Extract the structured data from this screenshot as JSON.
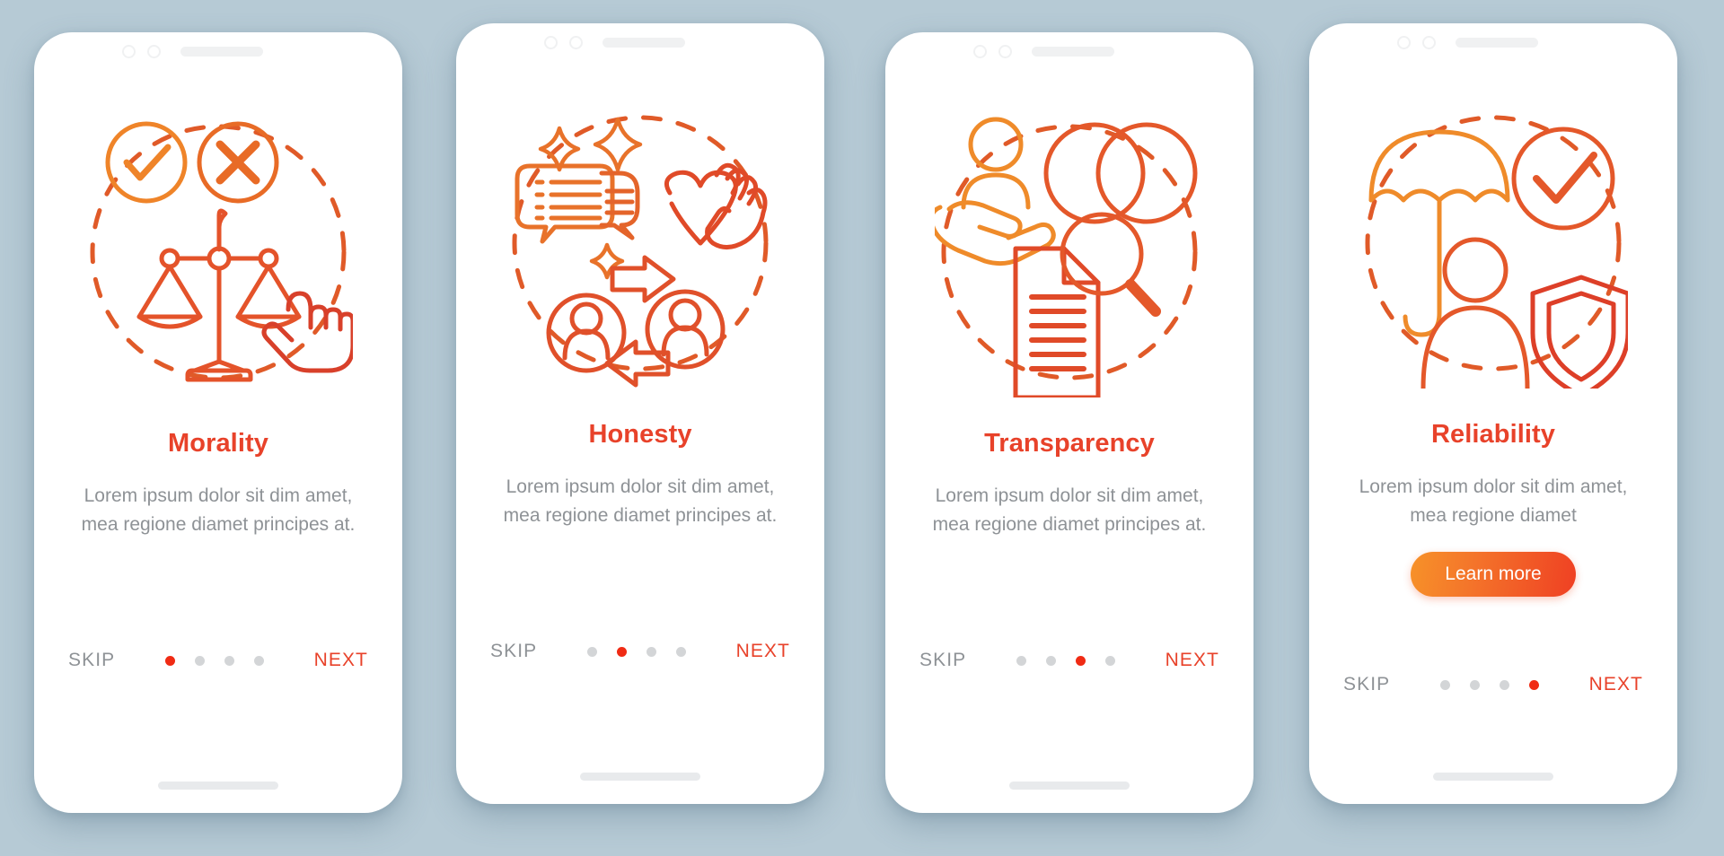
{
  "background_color": "#b6cad5",
  "theme": {
    "title_color": "#e8422a",
    "body_text_color": "#8e9296",
    "accent_dot_color": "#f02b14",
    "inactive_dot_color": "#d3d5d7",
    "cta_gradient_from": "#f79229",
    "cta_gradient_to": "#ef4023"
  },
  "common": {
    "skip_label": "SKIP",
    "next_label": "NEXT",
    "total_dots": 4
  },
  "screens": [
    {
      "id": "morality",
      "title": "Morality",
      "description": "Lorem ipsum dolor sit dim amet, mea regione diamet principes at.",
      "active_dot": 1,
      "has_cta": false,
      "cta_label": "",
      "illustration_name": "morality-illustration",
      "illustration_elements": [
        "check-circle-icon",
        "cross-circle-icon",
        "balance-scale-icon",
        "pointing-hand-icon",
        "dashed-circle-decoration"
      ]
    },
    {
      "id": "honesty",
      "title": "Honesty",
      "description": "Lorem ipsum dolor sit dim amet, mea regione diamet principes at.",
      "active_dot": 2,
      "has_cta": false,
      "cta_label": "",
      "illustration_name": "honesty-illustration",
      "illustration_elements": [
        "speech-bubbles-icon",
        "heart-with-hand-icon",
        "sparkle-icon",
        "two-people-exchange-icon",
        "arrow-right-icon",
        "arrow-left-icon",
        "dashed-circle-decoration"
      ]
    },
    {
      "id": "transparency",
      "title": "Transparency",
      "description": "Lorem ipsum dolor sit dim amet, mea regione diamet principes at.",
      "active_dot": 3,
      "has_cta": false,
      "cta_label": "",
      "illustration_name": "transparency-illustration",
      "illustration_elements": [
        "person-on-hand-icon",
        "overlapping-circles-icon",
        "document-with-magnifier-icon",
        "dashed-circle-decoration"
      ]
    },
    {
      "id": "reliability",
      "title": "Reliability",
      "description": "Lorem ipsum dolor sit dim amet, mea regione diamet",
      "active_dot": 4,
      "has_cta": true,
      "cta_label": "Learn more",
      "illustration_name": "reliability-illustration",
      "illustration_elements": [
        "umbrella-icon",
        "check-circle-icon",
        "person-with-shield-icon",
        "dashed-circle-decoration"
      ]
    }
  ]
}
